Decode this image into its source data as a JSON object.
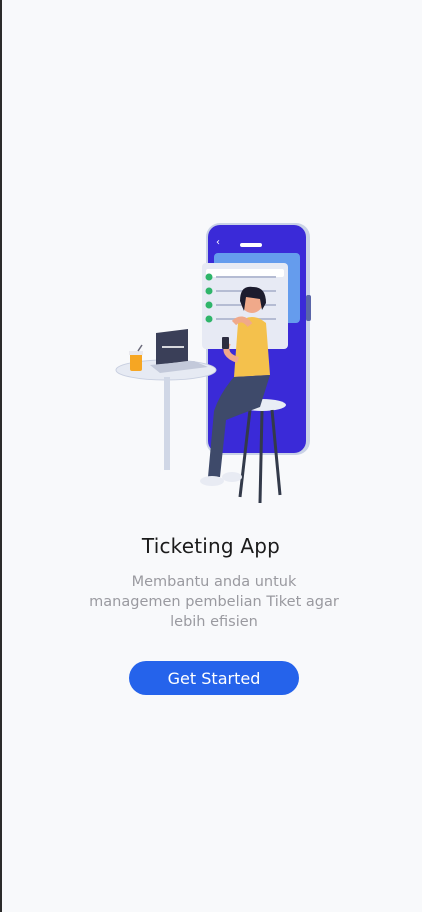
{
  "onboarding": {
    "title": "Ticketing App",
    "description": "Membantu anda untuk managemen pembelian Tiket agar lebih efisien",
    "cta_label": "Get Started"
  },
  "illustration": {
    "name": "woman-using-phone-ticketing-illustration"
  },
  "colors": {
    "background": "#f8f9fb",
    "primary": "#2563eb",
    "title": "#1b1b1b",
    "subtitle": "#9a9aa0"
  }
}
